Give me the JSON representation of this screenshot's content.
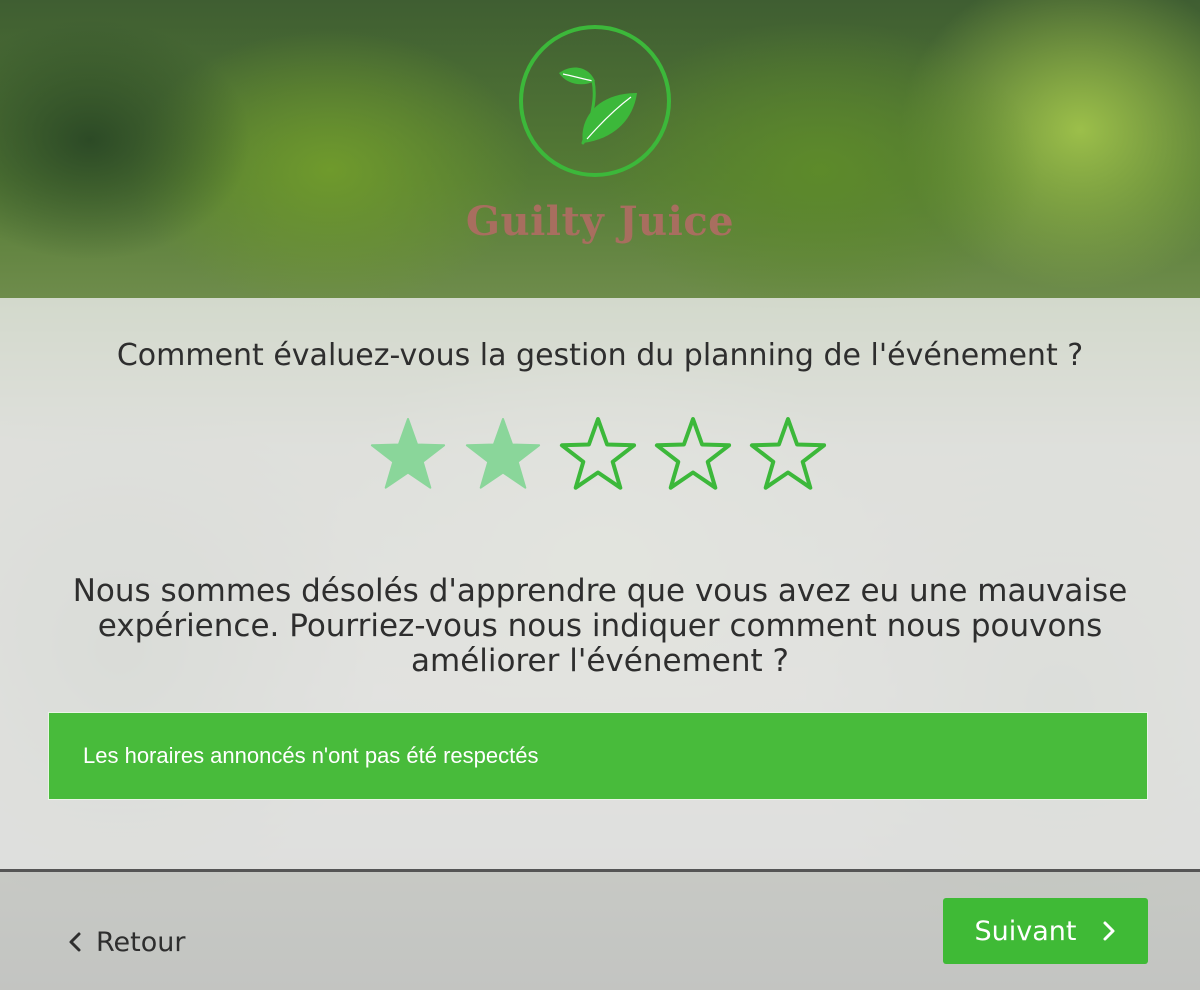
{
  "brand": {
    "name": "Guilty Juice",
    "logo_icon": "leaves-icon",
    "accent_color": "#3cb83a",
    "name_color": "#a86e5f"
  },
  "survey": {
    "question": "Comment évaluez-vous la gestion du planning de l'événement ?",
    "rating": {
      "max": 5,
      "selected": 2,
      "filled_color": "#8ad69a",
      "outline_color": "#3cb83a"
    },
    "followup": "Nous sommes désolés d'apprendre que vous avez eu une mauvaise expérience. Pourriez-vous nous indiquer comment nous pouvons améliorer l'événement ?",
    "answer_value": "Les horaires annoncés n'ont pas été respectés",
    "answer_bg": "#48bb3b"
  },
  "nav": {
    "back_label": "Retour",
    "back_icon": "chevron-left-icon",
    "next_label": "Suivant",
    "next_icon": "chevron-right-icon"
  }
}
